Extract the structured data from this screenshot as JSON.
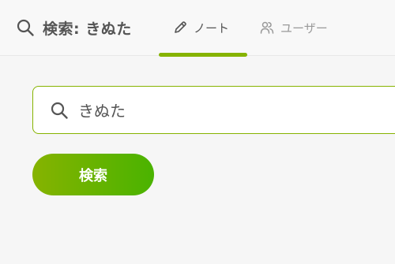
{
  "header": {
    "title": "検索: きぬた",
    "title_icon": "search-icon",
    "tabs": [
      {
        "label": "ノート",
        "icon": "pencil-icon",
        "active": true
      },
      {
        "label": "ユーザー",
        "icon": "users-icon",
        "active": false
      }
    ]
  },
  "search": {
    "value": "きぬた",
    "icon": "search-icon",
    "button_label": "検索"
  },
  "colors": {
    "accent": "#86b300",
    "accent_end": "#4ab300",
    "background": "#f6f6f6",
    "text": "#555555",
    "muted_text": "#999999"
  }
}
